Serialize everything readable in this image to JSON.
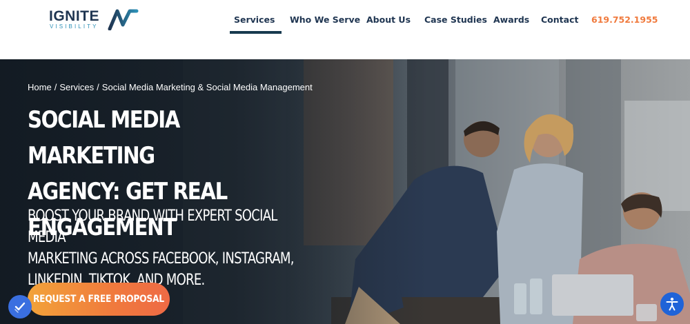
{
  "header": {
    "logo": {
      "wordmark": "IGNITE",
      "tagline": "VISIBILITY",
      "icon": "ignite-logo-mark"
    },
    "nav": [
      {
        "label": "Services",
        "active": true
      },
      {
        "label": "Who We Serve",
        "active": false
      },
      {
        "label": "About Us",
        "active": false
      },
      {
        "label": "Case Studies",
        "active": false
      },
      {
        "label": "Awards",
        "active": false
      },
      {
        "label": "Contact",
        "active": false
      }
    ],
    "phone": "619.752.1955"
  },
  "hero": {
    "breadcrumb": {
      "items": [
        "Home",
        "Services",
        "Social Media Marketing & Social Media Management"
      ],
      "separator": "/"
    },
    "title_lines": [
      "SOCIAL MEDIA MARKETING",
      "AGENCY: GET REAL",
      "ENGAGEMENT"
    ],
    "subtitle_lines": [
      "BOOST YOUR BRAND WITH EXPERT SOCIAL MEDIA",
      "MARKETING ACROSS FACEBOOK, INSTAGRAM,",
      "LINKEDIN, TIKTOK, AND MORE."
    ],
    "cta_label": "REQUEST A FREE PROPOSAL",
    "background_image": "office-team-meeting-photo"
  },
  "widgets": {
    "left_icon": "verified-check-icon",
    "right_icon": "accessibility-icon"
  },
  "colors": {
    "brand_navy": "#1f3551",
    "brand_blue": "#2c8fb6",
    "accent_orange": "#f07a3d",
    "cta_gradient_start": "#f2a33a",
    "cta_gradient_end": "#ee6a45",
    "active_underline": "#173a4f"
  }
}
